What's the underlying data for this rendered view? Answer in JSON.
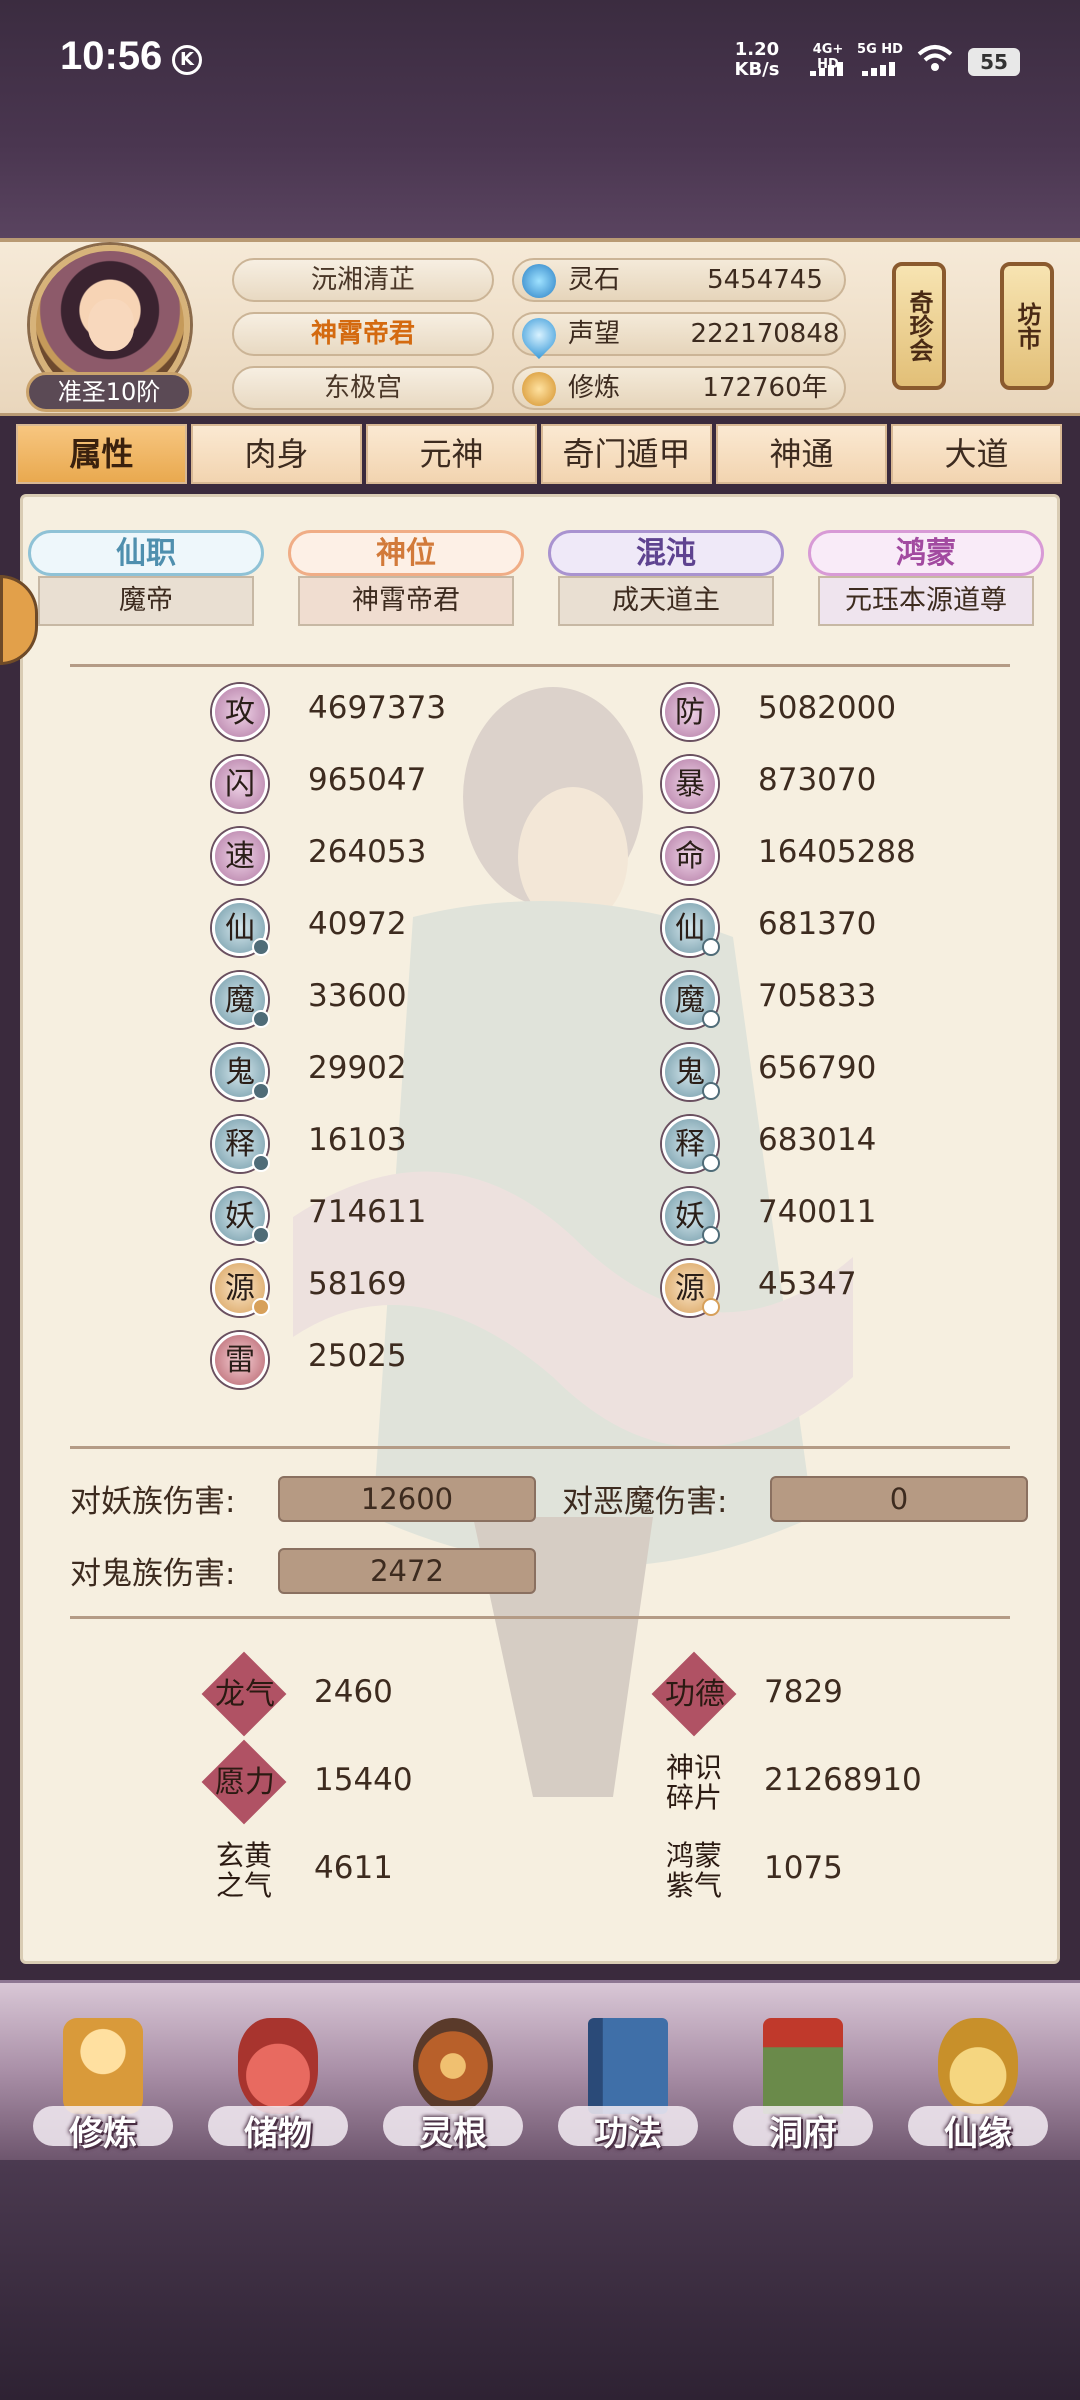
{
  "status_bar": {
    "time": "10:56",
    "k_badge": "K",
    "speed_value": "1.20",
    "speed_unit": "KB/s",
    "signal1": "4G+ HD",
    "signal2": "5G HD",
    "battery": "55"
  },
  "profile": {
    "rank": "准圣10阶",
    "name_lines": [
      "沅湘清芷",
      "神霄帝君",
      "东极宫"
    ]
  },
  "resources": [
    {
      "label": "灵石",
      "value": "5454745",
      "icon": "spirit-stone-icon"
    },
    {
      "label": "声望",
      "value": "222170848",
      "icon": "reputation-drop-icon"
    },
    {
      "label": "修炼",
      "value": "172760年",
      "icon": "meditation-icon"
    }
  ],
  "side_buttons": [
    "奇珍会",
    "坊市"
  ],
  "tabs": [
    "属性",
    "肉身",
    "元神",
    "奇门遁甲",
    "神通",
    "大道"
  ],
  "active_tab": 0,
  "rank_tags": [
    {
      "title": "仙职",
      "value": "魔帝",
      "color": "#5b9bb5"
    },
    {
      "title": "神位",
      "value": "神霄帝君",
      "color": "#d27a3a"
    },
    {
      "title": "混沌",
      "value": "成天道主",
      "color": "#7a5aa0"
    },
    {
      "title": "鸿蒙",
      "value": "元珏本源道尊",
      "color": "#a24aa0"
    }
  ],
  "stats_left": [
    {
      "glyph": "攻",
      "value": "4697373",
      "style": "p"
    },
    {
      "glyph": "闪",
      "value": "965047",
      "style": "p"
    },
    {
      "glyph": "速",
      "value": "264053",
      "style": "p"
    },
    {
      "glyph": "仙",
      "value": "40972",
      "style": "b"
    },
    {
      "glyph": "魔",
      "value": "33600",
      "style": "b"
    },
    {
      "glyph": "鬼",
      "value": "29902",
      "style": "b"
    },
    {
      "glyph": "释",
      "value": "16103",
      "style": "b"
    },
    {
      "glyph": "妖",
      "value": "714611",
      "style": "b"
    },
    {
      "glyph": "源",
      "value": "58169",
      "style": "o"
    },
    {
      "glyph": "雷",
      "value": "25025",
      "style": "r"
    }
  ],
  "stats_right": [
    {
      "glyph": "防",
      "value": "5082000",
      "style": "p"
    },
    {
      "glyph": "暴",
      "value": "873070",
      "style": "p"
    },
    {
      "glyph": "命",
      "value": "16405288",
      "style": "p"
    },
    {
      "glyph": "仙",
      "value": "681370",
      "style": "b"
    },
    {
      "glyph": "魔",
      "value": "705833",
      "style": "b"
    },
    {
      "glyph": "鬼",
      "value": "656790",
      "style": "b"
    },
    {
      "glyph": "释",
      "value": "683014",
      "style": "b"
    },
    {
      "glyph": "妖",
      "value": "740011",
      "style": "b"
    },
    {
      "glyph": "源",
      "value": "45347",
      "style": "o"
    }
  ],
  "damage": {
    "yao_label": "对妖族伤害:",
    "yao_value": "12600",
    "emo_label": "对恶魔伤害:",
    "emo_value": "0",
    "gui_label": "对鬼族伤害:",
    "gui_value": "2472"
  },
  "special_resources": [
    {
      "label": "龙气",
      "value": "2460"
    },
    {
      "label": "功德",
      "value": "7829"
    },
    {
      "label": "愿力",
      "value": "15440"
    },
    {
      "label": "神识碎片",
      "value": "21268910"
    },
    {
      "label": "玄黄之气",
      "value": "4611"
    },
    {
      "label": "鸿蒙紫气",
      "value": "1075"
    }
  ],
  "bottom_nav": [
    {
      "label": "修炼",
      "icon": "cultivation-figure-icon",
      "color": "#d99a3a"
    },
    {
      "label": "储物",
      "icon": "storage-bag-icon",
      "color": "#c8504a"
    },
    {
      "label": "灵根",
      "icon": "spirit-root-icon",
      "color": "#b8602a"
    },
    {
      "label": "功法",
      "icon": "technique-book-icon",
      "color": "#3f6fa8"
    },
    {
      "label": "洞府",
      "icon": "cave-mansion-icon",
      "color": "#6a8a4a"
    },
    {
      "label": "仙缘",
      "icon": "immortal-fate-icon",
      "color": "#e6b84a"
    }
  ]
}
